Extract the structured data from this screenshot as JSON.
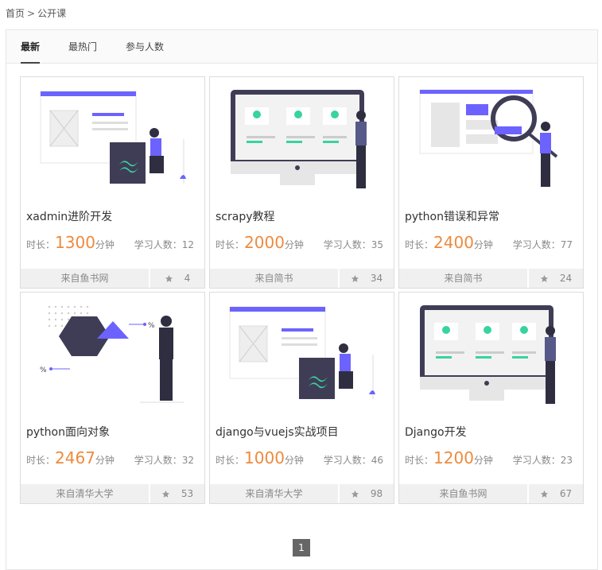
{
  "breadcrumb": {
    "home": "首页",
    "separator": ">",
    "current": "公开课"
  },
  "tabs": [
    {
      "label": "最新",
      "active": true
    },
    {
      "label": "最热门",
      "active": false
    },
    {
      "label": "参与人数",
      "active": false
    }
  ],
  "labels": {
    "duration_prefix": "时长：",
    "duration_unit": "分钟",
    "learners_prefix": "学习人数："
  },
  "courses": [
    {
      "title": "xadmin进阶开发",
      "duration": "1300",
      "learners": "12",
      "source": "来自鱼书网",
      "favorites": "4",
      "illustration": "admin-layout-with-tailwind-logo"
    },
    {
      "title": "scrapy教程",
      "duration": "2000",
      "learners": "35",
      "source": "来自简书",
      "favorites": "34",
      "illustration": "monitor-presenter"
    },
    {
      "title": "python错误和异常",
      "duration": "2400",
      "learners": "77",
      "source": "来自简书",
      "favorites": "24",
      "illustration": "magnifier-search"
    },
    {
      "title": "python面向对象",
      "duration": "2467",
      "learners": "32",
      "source": "来自清华大学",
      "favorites": "53",
      "illustration": "shapes-percentage"
    },
    {
      "title": "django与vuejs实战项目",
      "duration": "1000",
      "learners": "46",
      "source": "来自清华大学",
      "favorites": "98",
      "illustration": "admin-layout-with-tailwind-logo"
    },
    {
      "title": "Django开发",
      "duration": "1200",
      "learners": "23",
      "source": "来自鱼书网",
      "favorites": "67",
      "illustration": "monitor-presenter"
    }
  ],
  "pagination": {
    "current": "1"
  },
  "colors": {
    "accent_orange": "#ee8a3e",
    "purple": "#6c63ff",
    "dark": "#3f3d56",
    "teal": "#38d39f"
  }
}
